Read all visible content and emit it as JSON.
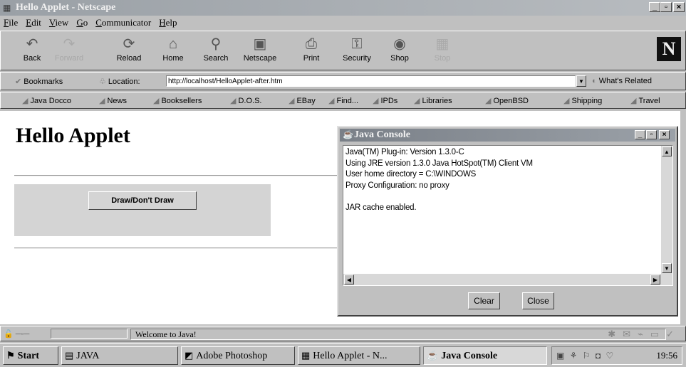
{
  "window": {
    "title": "Hello Applet - Netscape",
    "controls": {
      "minimize": "_",
      "maximize": "▫",
      "close": "×"
    }
  },
  "menu": [
    "File",
    "Edit",
    "View",
    "Go",
    "Communicator",
    "Help"
  ],
  "nav": [
    {
      "label": "Back",
      "icon": "back-arrow-icon",
      "glyph": "↶"
    },
    {
      "label": "Forward",
      "icon": "forward-arrow-icon",
      "glyph": "↷",
      "disabled": true
    },
    {
      "label": "Reload",
      "icon": "reload-icon",
      "glyph": "⟳"
    },
    {
      "label": "Home",
      "icon": "home-icon",
      "glyph": "⌂"
    },
    {
      "label": "Search",
      "icon": "search-icon",
      "glyph": "⚲"
    },
    {
      "label": "Netscape",
      "icon": "netscape-icon",
      "glyph": "▣"
    },
    {
      "label": "Print",
      "icon": "print-icon",
      "glyph": "⎙"
    },
    {
      "label": "Security",
      "icon": "security-icon",
      "glyph": "⚿"
    },
    {
      "label": "Shop",
      "icon": "shop-icon",
      "glyph": "◉"
    },
    {
      "label": "Stop",
      "icon": "stop-icon",
      "glyph": "▦",
      "disabled": true
    }
  ],
  "brand": "N",
  "location": {
    "bookmarks": "Bookmarks",
    "label": "Location:",
    "url": "http://localhost/HelloApplet-after.htm",
    "related": "What's Related"
  },
  "personal": [
    "Java Docco",
    "News",
    "Booksellers",
    "D.O.S.",
    "EBay",
    "Find...",
    "IPDs",
    "Libraries",
    "OpenBSD",
    "Shipping",
    "Travel"
  ],
  "page": {
    "heading": "Hello Applet",
    "button": "Draw/Don't Draw"
  },
  "console": {
    "title": "Java Console",
    "lines": [
      "Java(TM) Plug-in: Version 1.3.0-C",
      "Using JRE version 1.3.0 Java HotSpot(TM) Client VM",
      "User home directory = C:\\WINDOWS",
      "Proxy Configuration: no proxy",
      "",
      "JAR cache enabled."
    ],
    "clear": "Clear",
    "close": "Close"
  },
  "status": {
    "message": "Welcome to Java!"
  },
  "taskbar": {
    "start": "Start",
    "items": [
      {
        "label": "JAVA",
        "icon": "folder-icon"
      },
      {
        "label": "Adobe Photoshop",
        "icon": "photoshop-icon"
      },
      {
        "label": "Hello Applet - N...",
        "icon": "netscape-window-icon"
      },
      {
        "label": "Java Console",
        "icon": "java-console-icon",
        "active": true
      }
    ],
    "clock": "19:56"
  }
}
